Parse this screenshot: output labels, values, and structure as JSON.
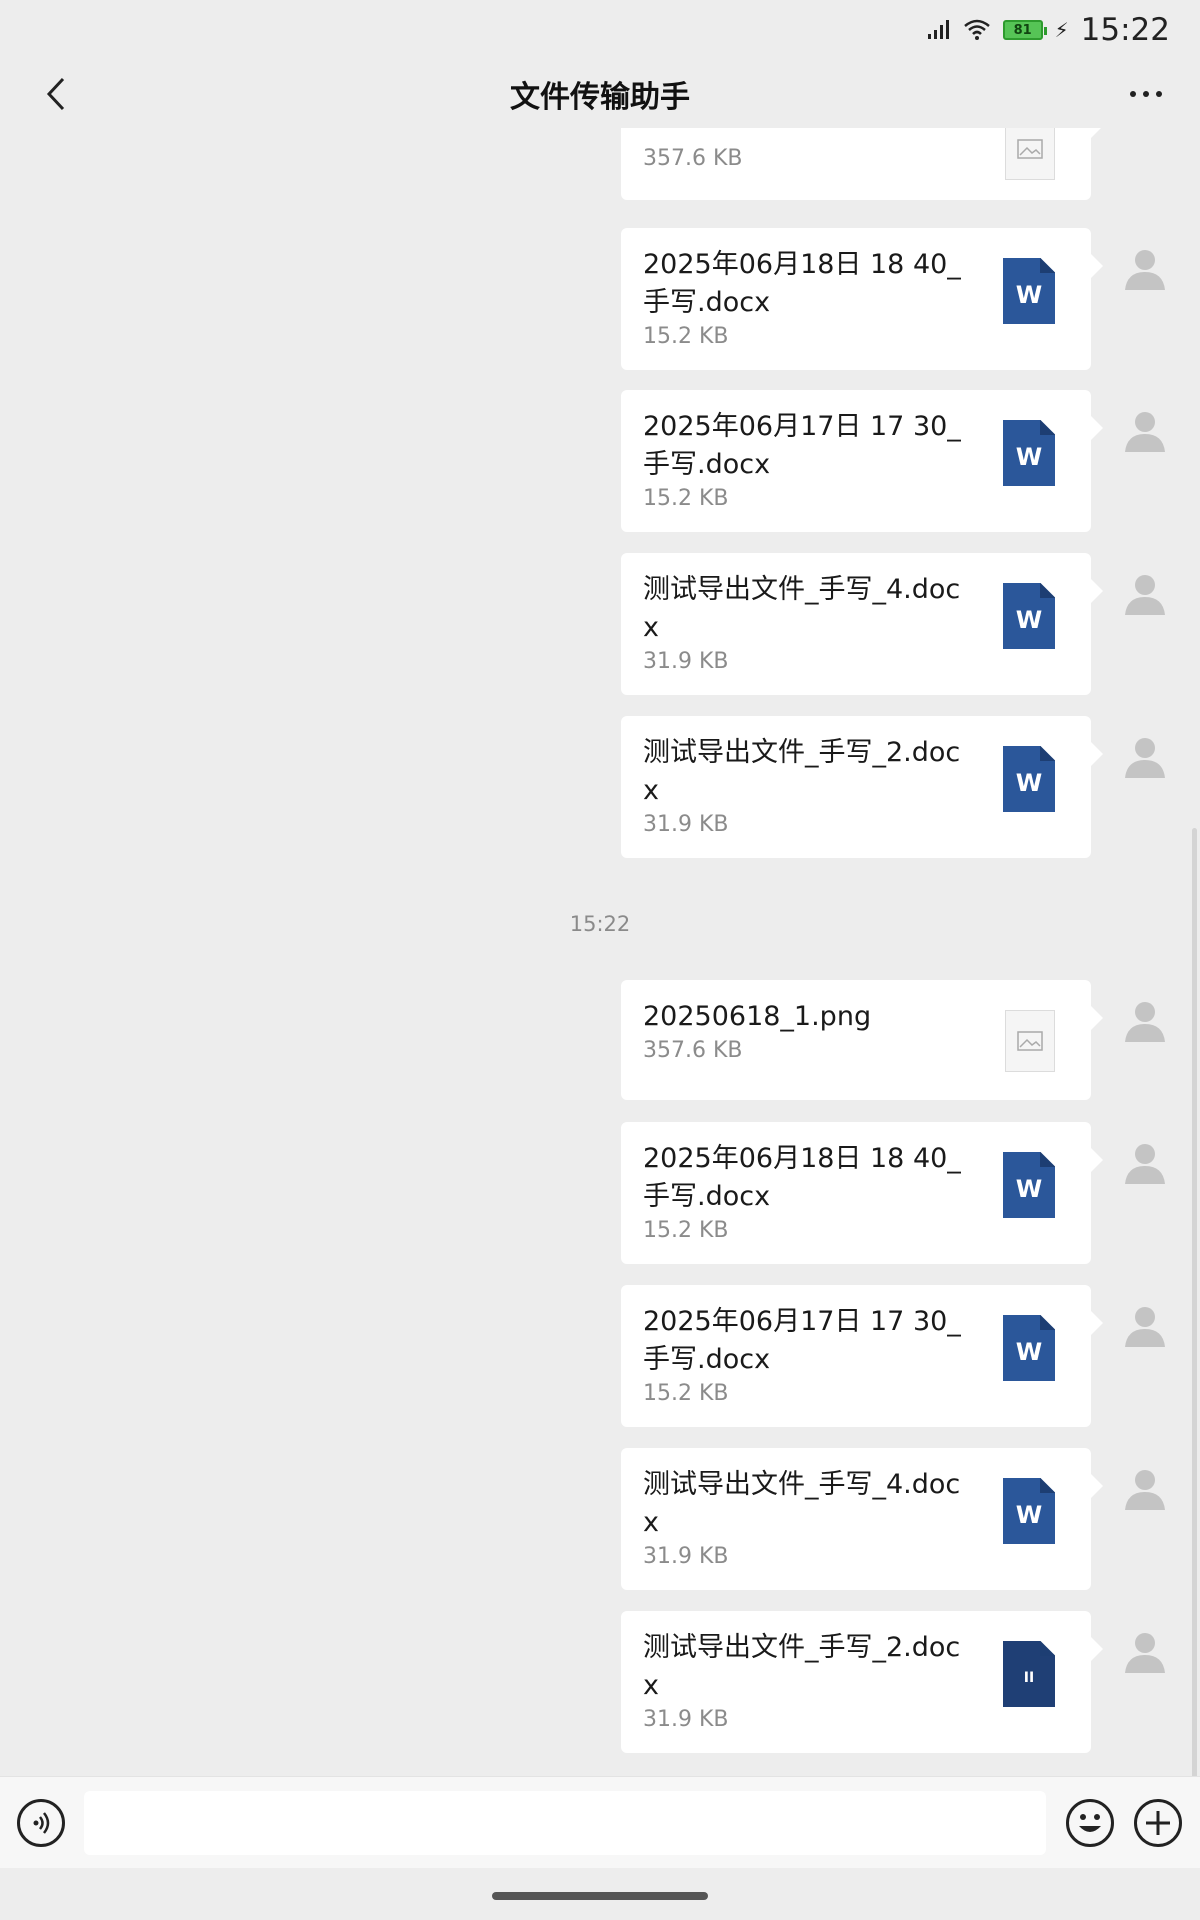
{
  "status_bar": {
    "battery": "81",
    "time": "15:22"
  },
  "nav": {
    "title": "文件传输助手"
  },
  "messages_top": [
    {
      "name": "",
      "size": "357.6 KB",
      "type": "image"
    },
    {
      "name": "2025年06月18日 18 40_手写.docx",
      "size": "15.2 KB",
      "type": "doc"
    },
    {
      "name": "2025年06月17日 17 30_手写.docx",
      "size": "15.2 KB",
      "type": "doc"
    },
    {
      "name": "测试导出文件_手写_4.docx",
      "size": "31.9 KB",
      "type": "doc"
    },
    {
      "name": "测试导出文件_手写_2.docx",
      "size": "31.9 KB",
      "type": "doc"
    }
  ],
  "timestamp": "15:22",
  "messages_bottom": [
    {
      "name": "20250618_1.png",
      "size": "357.6 KB",
      "type": "image"
    },
    {
      "name": "2025年06月18日 18 40_手写.docx",
      "size": "15.2 KB",
      "type": "doc"
    },
    {
      "name": "2025年06月17日 17 30_手写.docx",
      "size": "15.2 KB",
      "type": "doc"
    },
    {
      "name": "测试导出文件_手写_4.docx",
      "size": "31.9 KB",
      "type": "doc"
    },
    {
      "name": "测试导出文件_手写_2.docx",
      "size": "31.9 KB",
      "type": "doc"
    }
  ],
  "doc_icon_letter": "W",
  "colors": {
    "background": "#ededed",
    "bubble": "#ffffff",
    "word_blue": "#2b579a"
  },
  "icons": [
    "back-icon",
    "more-icon",
    "voice-icon",
    "emoji-icon",
    "plus-icon",
    "avatar-icon",
    "image-file-icon",
    "word-file-icon"
  ]
}
